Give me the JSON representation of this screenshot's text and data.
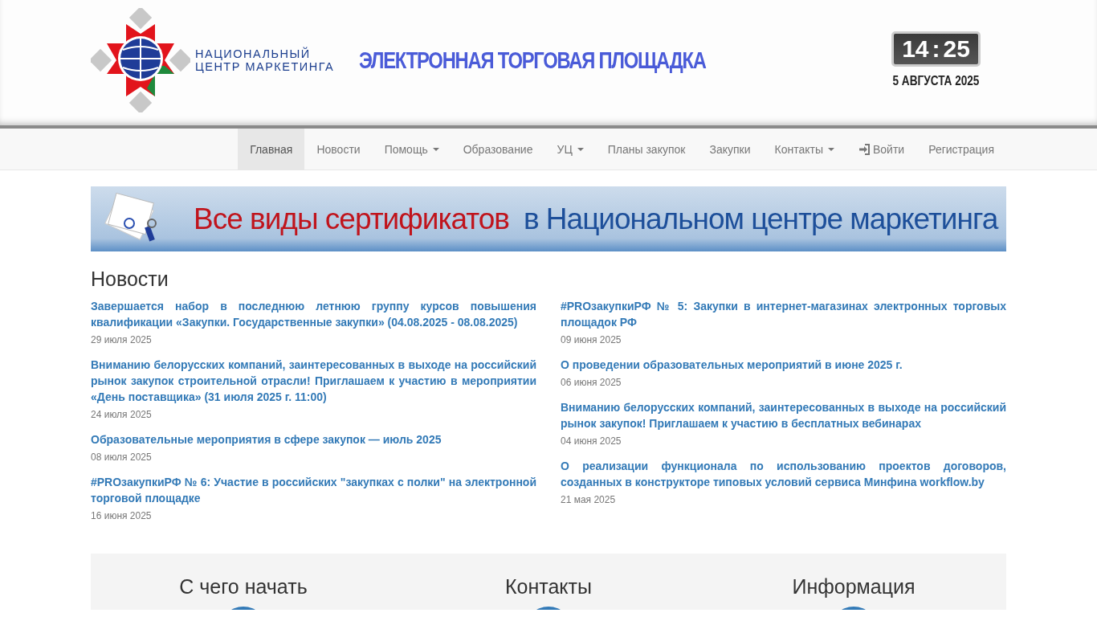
{
  "header": {
    "logo_lines": [
      "НАЦИОНАЛЬНЫЙ",
      "ЦЕНТР МАРКЕТИНГА"
    ],
    "title": "ЭЛЕКТРОННАЯ ТОРГОВАЯ ПЛОЩАДКА",
    "clock": {
      "hours": "14",
      "separator": ":",
      "minutes": "25"
    },
    "date": "5 АВГУСТА 2025"
  },
  "nav": [
    {
      "label": "Главная",
      "kind": "link",
      "selected": true
    },
    {
      "label": "Новости",
      "kind": "link",
      "selected": false
    },
    {
      "label": "Помощь",
      "kind": "dropdown",
      "selected": false
    },
    {
      "label": "Образование",
      "kind": "link",
      "selected": false
    },
    {
      "label": "УЦ",
      "kind": "dropdown",
      "selected": false
    },
    {
      "label": "Планы закупок",
      "kind": "link",
      "selected": false
    },
    {
      "label": "Закупки",
      "kind": "link",
      "selected": false
    },
    {
      "label": "Контакты",
      "kind": "dropdown",
      "selected": false
    },
    {
      "label": "Войти",
      "kind": "login",
      "selected": false
    },
    {
      "label": "Регистрация",
      "kind": "link",
      "selected": false
    }
  ],
  "banner": {
    "text_red": "Все виды сертификатов",
    "text_blue": "в Национальном центре маркетинга"
  },
  "news": {
    "title": "Новости",
    "columns": [
      [
        {
          "title": "Завершается набор в последнюю летнюю группу курсов повышения квалификации «Закупки. Государственные закупки» (04.08.2025 - 08.08.2025)",
          "date": "29 июля 2025"
        },
        {
          "title": "Вниманию белорусских компаний, заинтересованных в выходе на российский рынок закупок строительной отрасли! Приглашаем к участию в мероприятии «День поставщика» (31 июля 2025 г. 11:00)",
          "date": "24 июля 2025"
        },
        {
          "title": "Образовательные мероприятия в сфере закупок — июль 2025",
          "date": "08 июля 2025"
        },
        {
          "title": "#PROзакупкиРФ № 6: Участие в российских \"закупках с полки\" на электронной торговой площадке",
          "date": "16 июня 2025"
        }
      ],
      [
        {
          "title": "#PROзакупкиРФ № 5: Закупки в интернет-магазинах электронных торговых площадок РФ",
          "date": "09 июня 2025"
        },
        {
          "title": "О проведении образовательных мероприятий в июне 2025 г.",
          "date": "06 июня 2025"
        },
        {
          "title": "Вниманию белорусских компаний, заинтересованных в выходе на российский рынок закупок! Приглашаем к участию в бесплатных вебинарах",
          "date": "04 июня 2025"
        },
        {
          "title": "О реализации функционала по использованию проектов договоров, созданных в конструкторе типовых условий сервиса Минфина workflow.by",
          "date": "21 мая 2025"
        }
      ]
    ]
  },
  "info_panel": [
    {
      "title": "С чего начать"
    },
    {
      "title": "Контакты"
    },
    {
      "title": "Информация"
    }
  ]
}
